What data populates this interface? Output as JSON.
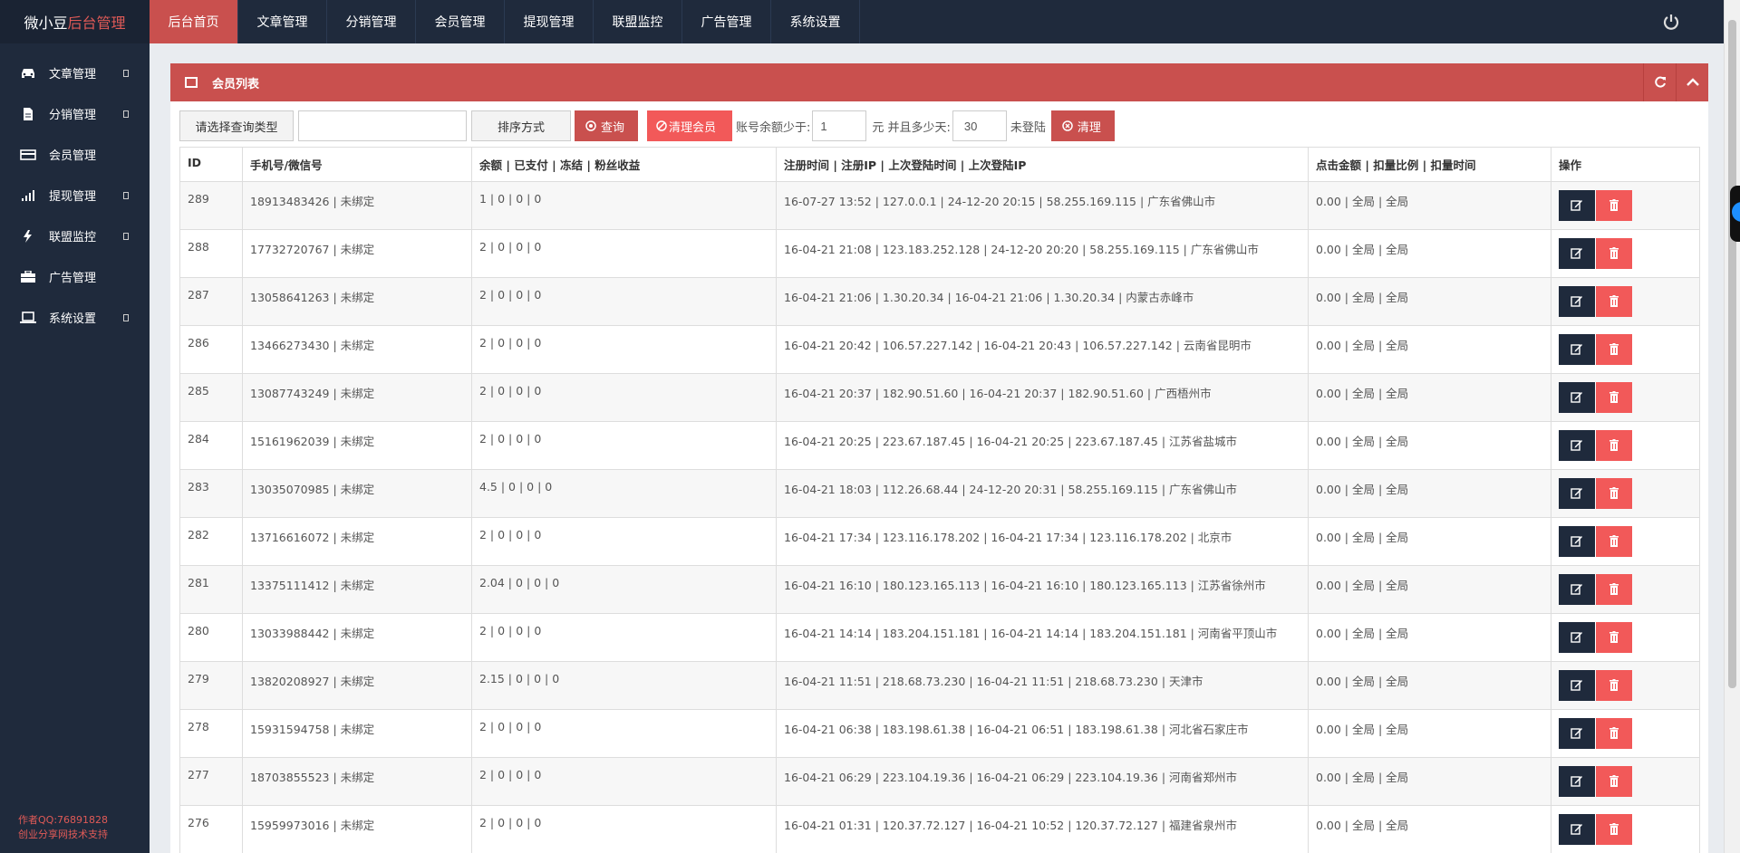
{
  "app": {
    "logo_main": "微小豆",
    "logo_accent": "后台管理"
  },
  "topnav": [
    {
      "label": "后台首页",
      "active": true
    },
    {
      "label": "文章管理"
    },
    {
      "label": "分销管理"
    },
    {
      "label": "会员管理"
    },
    {
      "label": "提现管理"
    },
    {
      "label": "联盟监控"
    },
    {
      "label": "广告管理"
    },
    {
      "label": "系统设置"
    }
  ],
  "sidebar": {
    "items": [
      {
        "label": "文章管理",
        "icon": "car-icon"
      },
      {
        "label": "分销管理",
        "icon": "file-icon"
      },
      {
        "label": "会员管理",
        "icon": "card-icon"
      },
      {
        "label": "提现管理",
        "icon": "signal-icon"
      },
      {
        "label": "联盟监控",
        "icon": "bolt-icon"
      },
      {
        "label": "广告管理",
        "icon": "briefcase-icon"
      },
      {
        "label": "系统设置",
        "icon": "laptop-icon"
      }
    ],
    "credit_line1": "作者QQ:76891828",
    "credit_line2": "创业分享网技术支持"
  },
  "panel": {
    "title": "会员列表"
  },
  "toolbar": {
    "query_type": "请选择查询类型",
    "search_value": "",
    "sort": "排序方式",
    "query_btn": "查询",
    "clear_members_btn": "清理会员",
    "balance_label": "账号余额少于:",
    "balance_value": "1",
    "days_label": "元 并且多少天:",
    "days_value": "30",
    "not_login_label": "未登陆",
    "clear_btn": "清理"
  },
  "table": {
    "headers": [
      "ID",
      "手机号/微信号",
      "余额 | 已支付 | 冻结 | 粉丝收益",
      "注册时间 | 注册IP | 上次登陆时间 | 上次登陆IP",
      "点击金额 | 扣量比例 | 扣量时间",
      "操作"
    ],
    "rows": [
      [
        "289",
        "18913483426 | 未绑定",
        "1 | 0 | 0 | 0",
        "16-07-27 13:52 | 127.0.0.1 | 24-12-20 20:15 | 58.255.169.115 | 广东省佛山市",
        "0.00 | 全局 | 全局"
      ],
      [
        "288",
        "17732720767 | 未绑定",
        "2 | 0 | 0 | 0",
        "16-04-21 21:08 | 123.183.252.128 | 24-12-20 20:20 | 58.255.169.115 | 广东省佛山市",
        "0.00 | 全局 | 全局"
      ],
      [
        "287",
        "13058641263 | 未绑定",
        "2 | 0 | 0 | 0",
        "16-04-21 21:06 | 1.30.20.34 | 16-04-21 21:06 | 1.30.20.34 | 内蒙古赤峰市",
        "0.00 | 全局 | 全局"
      ],
      [
        "286",
        "13466273430 | 未绑定",
        "2 | 0 | 0 | 0",
        "16-04-21 20:42 | 106.57.227.142 | 16-04-21 20:43 | 106.57.227.142 | 云南省昆明市",
        "0.00 | 全局 | 全局"
      ],
      [
        "285",
        "13087743249 | 未绑定",
        "2 | 0 | 0 | 0",
        "16-04-21 20:37 | 182.90.51.60 | 16-04-21 20:37 | 182.90.51.60 | 广西梧州市",
        "0.00 | 全局 | 全局"
      ],
      [
        "284",
        "15161962039 | 未绑定",
        "2 | 0 | 0 | 0",
        "16-04-21 20:25 | 223.67.187.45 | 16-04-21 20:25 | 223.67.187.45 | 江苏省盐城市",
        "0.00 | 全局 | 全局"
      ],
      [
        "283",
        "13035070985 | 未绑定",
        "4.5 | 0 | 0 | 0",
        "16-04-21 18:03 | 112.26.68.44 | 24-12-20 20:31 | 58.255.169.115 | 广东省佛山市",
        "0.00 | 全局 | 全局"
      ],
      [
        "282",
        "13716616072 | 未绑定",
        "2 | 0 | 0 | 0",
        "16-04-21 17:34 | 123.116.178.202 | 16-04-21 17:34 | 123.116.178.202 | 北京市",
        "0.00 | 全局 | 全局"
      ],
      [
        "281",
        "13375111412 | 未绑定",
        "2.04 | 0 | 0 | 0",
        "16-04-21 16:10 | 180.123.165.113 | 16-04-21 16:10 | 180.123.165.113 | 江苏省徐州市",
        "0.00 | 全局 | 全局"
      ],
      [
        "280",
        "13033988442 | 未绑定",
        "2 | 0 | 0 | 0",
        "16-04-21 14:14 | 183.204.151.181 | 16-04-21 14:14 | 183.204.151.181 | 河南省平顶山市",
        "0.00 | 全局 | 全局"
      ],
      [
        "279",
        "13820208927 | 未绑定",
        "2.15 | 0 | 0 | 0",
        "16-04-21 11:51 | 218.68.73.230 | 16-04-21 11:51 | 218.68.73.230 | 天津市",
        "0.00 | 全局 | 全局"
      ],
      [
        "278",
        "15931594758 | 未绑定",
        "2 | 0 | 0 | 0",
        "16-04-21 06:38 | 183.198.61.38 | 16-04-21 06:51 | 183.198.61.38 | 河北省石家庄市",
        "0.00 | 全局 | 全局"
      ],
      [
        "277",
        "18703855523 | 未绑定",
        "2 | 0 | 0 | 0",
        "16-04-21 06:29 | 223.104.19.36 | 16-04-21 06:29 | 223.104.19.36 | 河南省郑州市",
        "0.00 | 全局 | 全局"
      ],
      [
        "276",
        "15959973016 | 未绑定",
        "2 | 0 | 0 | 0",
        "16-04-21 01:31 | 120.37.72.127 | 16-04-21 10:52 | 120.37.72.127 | 福建省泉州市",
        "0.00 | 全局 | 全局"
      ]
    ]
  }
}
